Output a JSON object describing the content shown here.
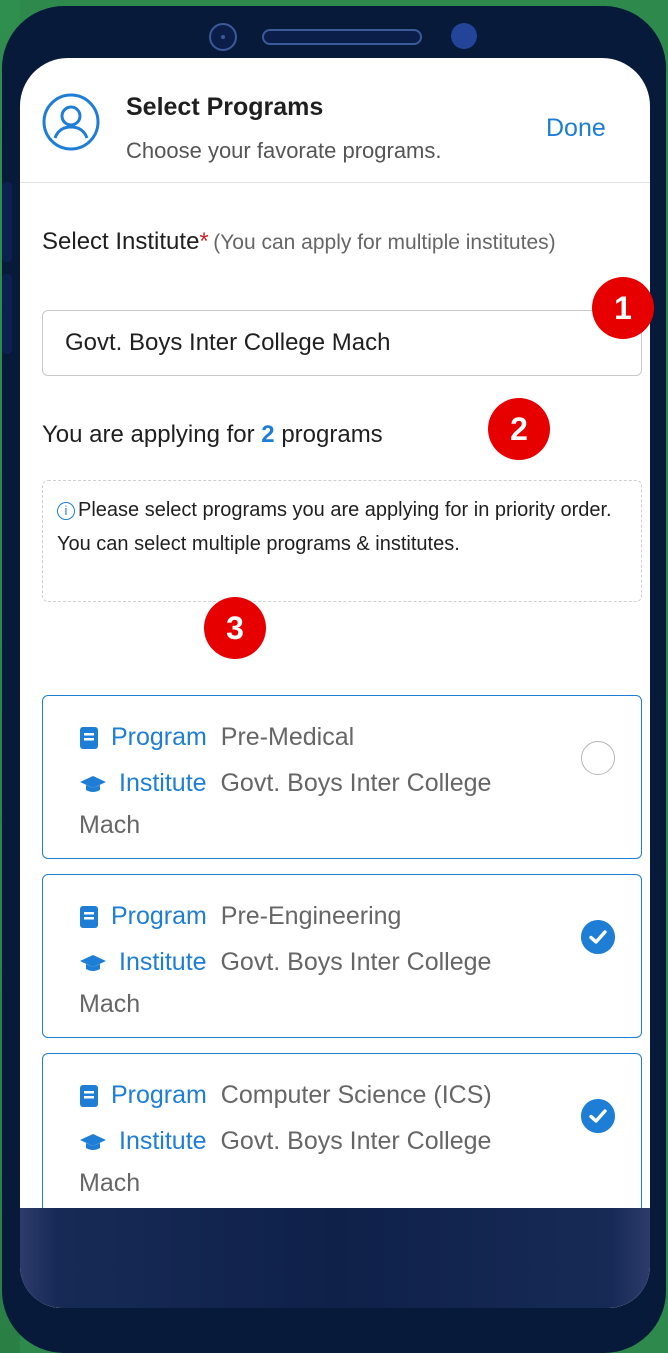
{
  "header": {
    "title": "Select Programs",
    "subtitle": "Choose your favorate programs.",
    "done_label": "Done"
  },
  "form": {
    "label": "Select Institute",
    "required_mark": "*",
    "hint": "(You can apply for multiple institutes)",
    "selected_institute": "Govt. Boys Inter College Mach"
  },
  "summary": {
    "prefix": "You are applying for",
    "count": "2",
    "suffix": "programs"
  },
  "info": {
    "icon": "i",
    "text": "Please select programs you are applying for in priority order. You can select multiple programs & institutes."
  },
  "cards": [
    {
      "program_label": "Program",
      "program": "Pre-Medical",
      "institute_label": "Institute",
      "institute": "Govt. Boys Inter College Mach",
      "selected": false
    },
    {
      "program_label": "Program",
      "program": "Pre-Engineering",
      "institute_label": "Institute",
      "institute": "Govt. Boys Inter College Mach",
      "selected": true
    },
    {
      "program_label": "Program",
      "program": "Computer Science (ICS)",
      "institute_label": "Institute",
      "institute": "Govt. Boys Inter College Mach",
      "selected": true
    }
  ],
  "badges": [
    "1",
    "2",
    "3"
  ],
  "colors": {
    "accent": "#1e7ed6",
    "badge": "#e60000",
    "required": "#c62828",
    "frame": "#071a3a",
    "background": "#2e8a4c"
  }
}
